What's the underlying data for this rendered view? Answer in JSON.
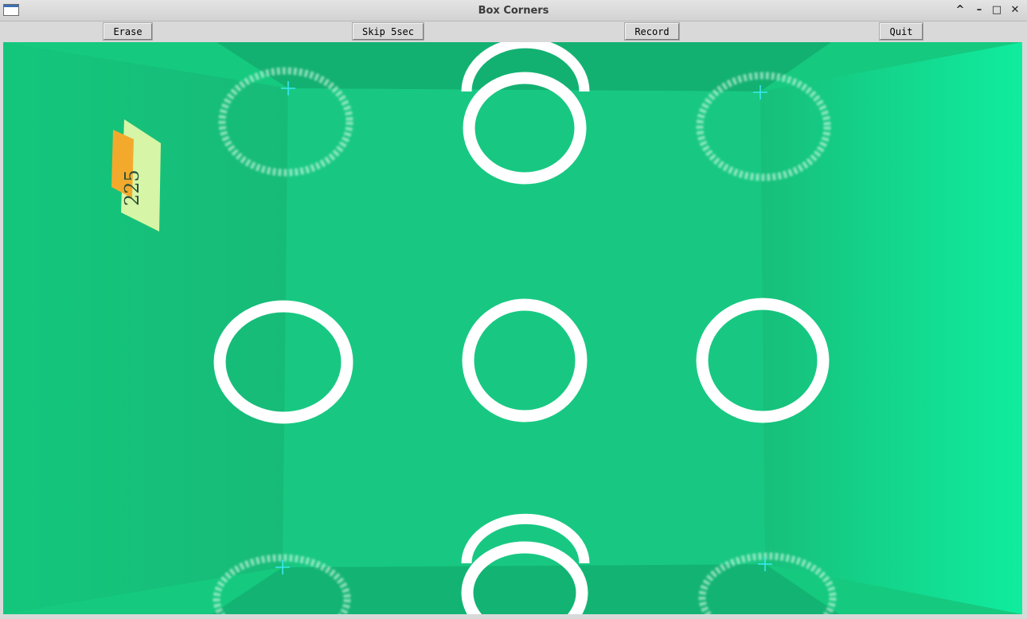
{
  "window": {
    "title": "Box Corners",
    "controls": [
      "^",
      "–",
      "□",
      "✕"
    ]
  },
  "toolbar": {
    "erase_label": "Erase",
    "skip_label": "Skip 5sec",
    "record_label": "Record",
    "quit_label": "Quit"
  },
  "camera_view": {
    "tag_text": "225",
    "marker_color": "#38e8f0",
    "background_color": "#15c97f"
  }
}
